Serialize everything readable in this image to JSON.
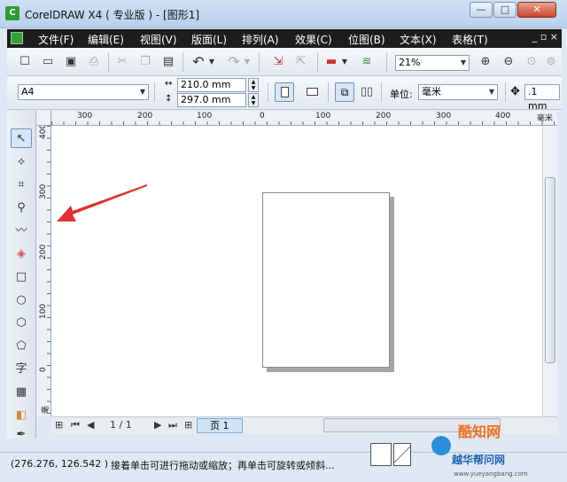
{
  "window": {
    "title": "CorelDRAW X4 ( 专业版 ) - [图形1]",
    "icon_glyph": "C",
    "minimize": "—",
    "maximize": "□",
    "close": "✕"
  },
  "menu": {
    "items": [
      "文件(F)",
      "编辑(E)",
      "视图(V)",
      "版面(L)",
      "排列(A)",
      "效果(C)",
      "位图(B)",
      "文本(X)",
      "表格(T)"
    ],
    "doc_controls": "_ ▫ ×"
  },
  "toolbar": {
    "zoom": "21%"
  },
  "properties": {
    "paper_size": "A4",
    "width": "210.0 mm",
    "height": "297.0 mm",
    "units_label": "单位:",
    "units_value": "毫米",
    "nudge": ".1 mm"
  },
  "ruler": {
    "h_labels": [
      "300",
      "200",
      "100",
      "0",
      "100",
      "200",
      "300",
      "400"
    ],
    "h_unit": "毫米",
    "v_labels": [
      "400",
      "300",
      "200",
      "100",
      "0"
    ],
    "v_unit": "毫米"
  },
  "page_nav": {
    "counter": "1 / 1",
    "tab": "页 1"
  },
  "status": {
    "coords": "(276.276, 126.542 )",
    "hint": "接着单击可进行拖动或缩放；再单击可旋转或倾斜..."
  },
  "watermark": {
    "brand1": "酷知网",
    "brand2": "越华帮问网",
    "url": "www.yueyangbang.com"
  },
  "colors": {
    "menubar_bg": "#1d1d1d",
    "arrow": "#e03030",
    "accent": "#2f9c2f"
  }
}
